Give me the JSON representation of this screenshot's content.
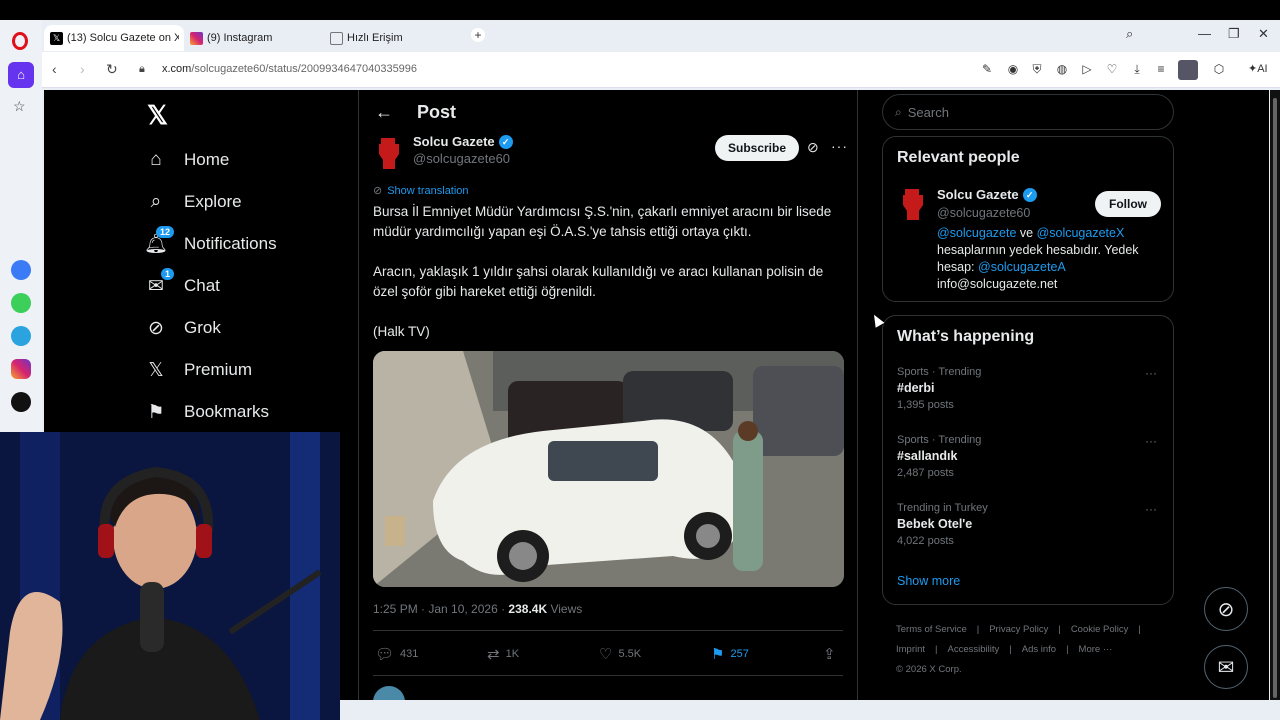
{
  "browser": {
    "tabs": [
      {
        "label": "(13) Solcu Gazete on X: \"B",
        "icon": "x-icon",
        "active": true
      },
      {
        "label": "(9) Instagram",
        "icon": "instagram-icon",
        "active": false
      },
      {
        "label": "Hızlı Erişim",
        "icon": "grid-icon",
        "active": false
      }
    ],
    "url_host": "x.com",
    "url_path": "/solcugazete60/status/2009934647040335996",
    "ai_label": "AI"
  },
  "nav": {
    "items": [
      {
        "label": "Home",
        "icon": "home-icon"
      },
      {
        "label": "Explore",
        "icon": "search-icon"
      },
      {
        "label": "Notifications",
        "icon": "bell-icon",
        "badge": "12"
      },
      {
        "label": "Chat",
        "icon": "mail-icon",
        "badge": "1"
      },
      {
        "label": "Grok",
        "icon": "grok-icon"
      },
      {
        "label": "Premium",
        "icon": "x-logo-icon"
      },
      {
        "label": "Bookmarks",
        "icon": "bookmark-icon"
      }
    ]
  },
  "post": {
    "header": "Post",
    "author_name": "Solcu Gazete",
    "author_handle": "@solcugazete60",
    "subscribe": "Subscribe",
    "show_translation": "Show translation",
    "text": [
      "Bursa İl Emniyet Müdür Yardımcısı Ş.S.'nin, çakarlı emniyet aracını bir lisede müdür yardımcılığı yapan eşi Ö.A.S.'ye tahsis ettiği ortaya çıktı.",
      "Aracın, yaklaşık 1 yıldır şahsi olarak kullanıldığı ve aracı kullanan polisin de özel şoför gibi hareket ettiği öğrenildi.",
      "(Halk TV)"
    ],
    "time": "1:25 PM · Jan 10, 2026 · ",
    "views": "238.4K",
    "views_label": " Views",
    "actions": {
      "replies": "431",
      "reposts": "1K",
      "likes": "5.5K",
      "bookmarks": "257"
    }
  },
  "sidebar": {
    "search_placeholder": "Search",
    "relevant_title": "Relevant people",
    "relevant": {
      "name": "Solcu Gazete",
      "handle": "@solcugazete60",
      "follow": "Follow",
      "bio_link1": "@solcugazete",
      "bio_ve": " ve ",
      "bio_link2": "@solcugazeteX",
      "bio_mid": " hesaplarının yedek hesabıdır. Yedek hesap: ",
      "bio_link3": "@solcugazeteA",
      "bio_email": "info@solcugazete.net"
    },
    "happening_title": "What’s happening",
    "trends": [
      {
        "category": "Sports · Trending",
        "title": "#derbi",
        "count": "1,395 posts"
      },
      {
        "category": "Sports · Trending",
        "title": "#sallandık",
        "count": "2,487 posts"
      },
      {
        "category": "Trending in Turkey",
        "title": "Bebek Otel'e",
        "count": "4,022 posts"
      }
    ],
    "show_more": "Show more",
    "footer": [
      "Terms of Service",
      "|",
      "Privacy Policy",
      "|",
      "Cookie Policy",
      "|",
      "Imprint",
      "|",
      "Accessibility",
      "|",
      "Ads info",
      "|",
      "More ···",
      "© 2026 X Corp."
    ]
  },
  "colors": {
    "accent": "#1d9bf0",
    "background": "#000000",
    "text": "#e7e9ea",
    "muted": "#71767b"
  }
}
